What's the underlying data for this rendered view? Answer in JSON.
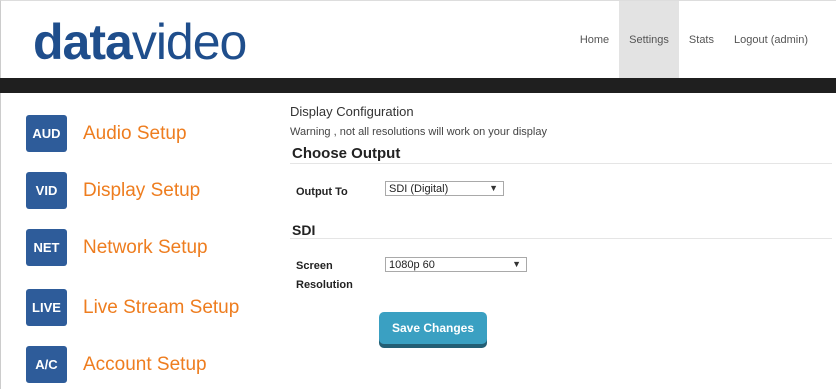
{
  "brand": {
    "part1": "data",
    "part2": "video"
  },
  "nav": {
    "items": [
      {
        "label": "Home"
      },
      {
        "label": "Settings",
        "active": true
      },
      {
        "label": "Stats"
      },
      {
        "label": "Logout (admin)"
      }
    ]
  },
  "sidebar": {
    "items": [
      {
        "badge": "AUD",
        "label": "Audio Setup"
      },
      {
        "badge": "VID",
        "label": "Display Setup"
      },
      {
        "badge": "NET",
        "label": "Network Setup"
      },
      {
        "badge": "LIVE",
        "label": "Live Stream Setup"
      },
      {
        "badge": "A/C",
        "label": "Account Setup"
      }
    ]
  },
  "main": {
    "title": "Display Configuration",
    "warning": "Warning , not all resolutions will work on your display",
    "choose_output": {
      "heading": "Choose Output",
      "label": "Output To",
      "value": "SDI (Digital)"
    },
    "sdi": {
      "heading": "SDI",
      "label_line1": "Screen",
      "label_line2": "Resolution",
      "value": "1080p 60"
    },
    "save_label": "Save Changes"
  },
  "colors": {
    "brand_blue": "#1f4e8c",
    "badge_blue": "#2e5c9a",
    "orange": "#ee7d1f",
    "button": "#3aa0c2",
    "dark_bar": "#1f1f1f"
  }
}
